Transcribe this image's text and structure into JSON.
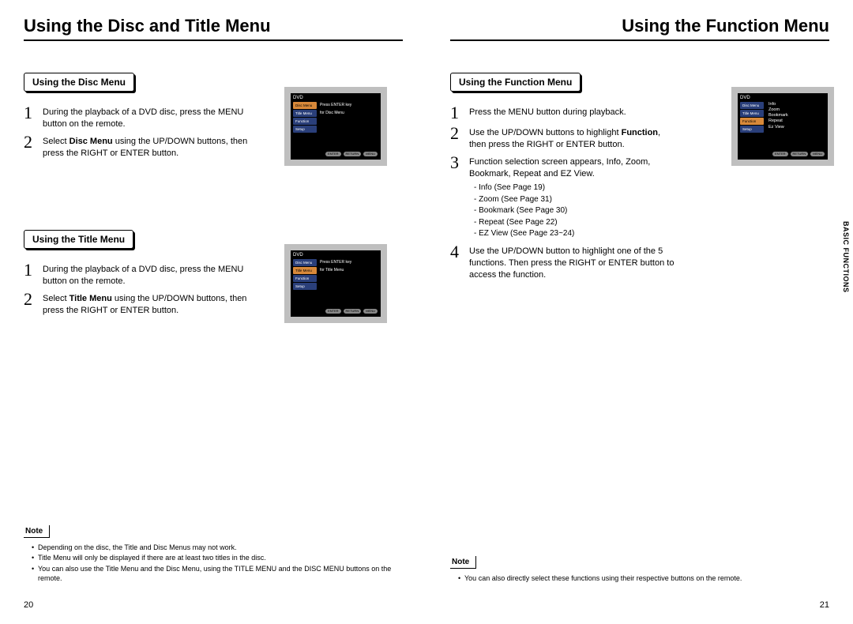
{
  "left_page": {
    "heading": "Using the Disc and Title Menu",
    "page_number": "20",
    "disc_menu": {
      "label": "Using the Disc Menu",
      "step1": "During the playback of a DVD disc, press the MENU button on the remote.",
      "step2_pre": "Select ",
      "step2_bold": "Disc Menu",
      "step2_post": " using the UP/DOWN buttons, then press the RIGHT or ENTER button."
    },
    "title_menu": {
      "label": "Using the Title Menu",
      "step1": "During the playback of a DVD disc, press the MENU button on the remote.",
      "step2_pre": "Select ",
      "step2_bold": "Title Menu",
      "step2_post": " using the UP/DOWN buttons, then press the RIGHT or ENTER button."
    },
    "note": {
      "label": "Note",
      "items": [
        "Depending on the disc, the Title and Disc Menus may not work.",
        "Title Menu will only be displayed if there are at least two titles in the disc.",
        "You can also use the Title Menu and the Disc Menu, using the TITLE MENU and the DISC MENU buttons on the remote."
      ]
    },
    "screen_disc": {
      "title": "DVD",
      "rows": [
        "Disc Menu",
        "Title Menu",
        "Function",
        "Setup"
      ],
      "hint1": "Press ENTER key",
      "hint2": "for Disc Menu",
      "footer_buttons": [
        "ENTER",
        "RETURN",
        "MENU"
      ]
    },
    "screen_title": {
      "title": "DVD",
      "rows": [
        "Disc Menu",
        "Title Menu",
        "Function",
        "Setup"
      ],
      "hint1": "Press ENTER key",
      "hint2": "for Title Menu",
      "footer_buttons": [
        "ENTER",
        "RETURN",
        "MENU"
      ]
    }
  },
  "right_page": {
    "heading": "Using the Function Menu",
    "page_number": "21",
    "section": {
      "label": "Using the Function Menu",
      "step1": "Press the MENU button during playback.",
      "step2_pre": "Use the UP/DOWN buttons to highlight ",
      "step2_bold": "Function",
      "step2_post": ", then press the RIGHT or ENTER button.",
      "step3": "Function selection screen appears, Info, Zoom, Bookmark, Repeat and EZ View.",
      "step3_sub": [
        "Info (See Page 19)",
        "Zoom (See Page 31)",
        "Bookmark (See Page 30)",
        "Repeat (See Page 22)",
        "EZ View (See Page 23~24)"
      ],
      "step4": "Use the UP/DOWN button to highlight one of the 5 functions. Then press the RIGHT or ENTER button to access the function."
    },
    "note": {
      "label": "Note",
      "items": [
        "You can also directly select these functions using their respective buttons on the remote."
      ]
    },
    "screen_function": {
      "title": "DVD",
      "rows": [
        "Disc Menu",
        "Title Menu",
        "Function",
        "Setup"
      ],
      "options": [
        "Info",
        "Zoom",
        "Bookmark",
        "Repeat",
        "Ez View"
      ],
      "footer_buttons": [
        "ENTER",
        "RETURN",
        "MENU"
      ]
    },
    "side_tab": "BASIC\nFUNCTIONS"
  }
}
